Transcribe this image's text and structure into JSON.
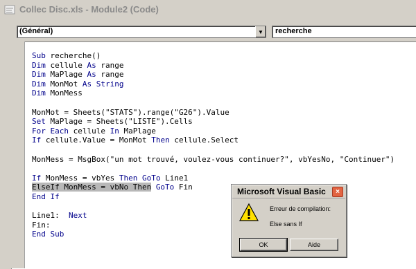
{
  "window": {
    "title": "Collec Disc.xls - Module2 (Code)"
  },
  "toolbar": {
    "object_combo": "(Général)",
    "procedure_combo": "recherche"
  },
  "code": {
    "l1a": "Sub",
    "l1b": " recherche()",
    "l2a": "Dim",
    "l2b": " cellule ",
    "l2c": "As",
    "l2d": " range",
    "l3a": "Dim",
    "l3b": " MaPlage ",
    "l3c": "As",
    "l3d": " range",
    "l4a": "Dim",
    "l4b": " MonMot ",
    "l4c": "As",
    "l4d": " ",
    "l4e": "String",
    "l5a": "Dim",
    "l5b": " MonMess",
    "l7": "MonMot = Sheets(\"STATS\").range(\"G26\").Value",
    "l8a": "Set",
    "l8b": " MaPlage = Sheets(\"LISTE\").Cells",
    "l9a": "For",
    "l9b": " ",
    "l9c": "Each",
    "l9d": " cellule ",
    "l9e": "In",
    "l9f": " MaPlage",
    "l10a": "If",
    "l10b": " cellule.Value = MonMot ",
    "l10c": "Then",
    "l10d": " cellule.Select",
    "l12": "MonMess = MsgBox(\"un mot trouvé, voulez-vous continuer?\", vbYesNo, \"Continuer\")",
    "l14a": "If",
    "l14b": " MonMess = vbYes ",
    "l14c": "Then",
    "l14d": " ",
    "l14e": "GoTo",
    "l14f": " Line1",
    "l15a": "ElseIf MonMess = vbNo Then",
    "l15b": " ",
    "l15c": "GoTo",
    "l15d": " Fin",
    "l16a": "End",
    "l16b": " ",
    "l16c": "If",
    "l18a": "Line1:  ",
    "l18b": "Next",
    "l19": "Fin:",
    "l20a": "End",
    "l20b": " ",
    "l20c": "Sub"
  },
  "dialog": {
    "title": "Microsoft Visual Basic",
    "message_line1": "Erreur de compilation:",
    "message_line2": "Else sans If",
    "ok_label": "OK",
    "help_label": "Aide",
    "close_glyph": "×"
  },
  "colors": {
    "keyword": "#00008b",
    "selection": "#b8b8b8",
    "close_button": "#e26442"
  }
}
